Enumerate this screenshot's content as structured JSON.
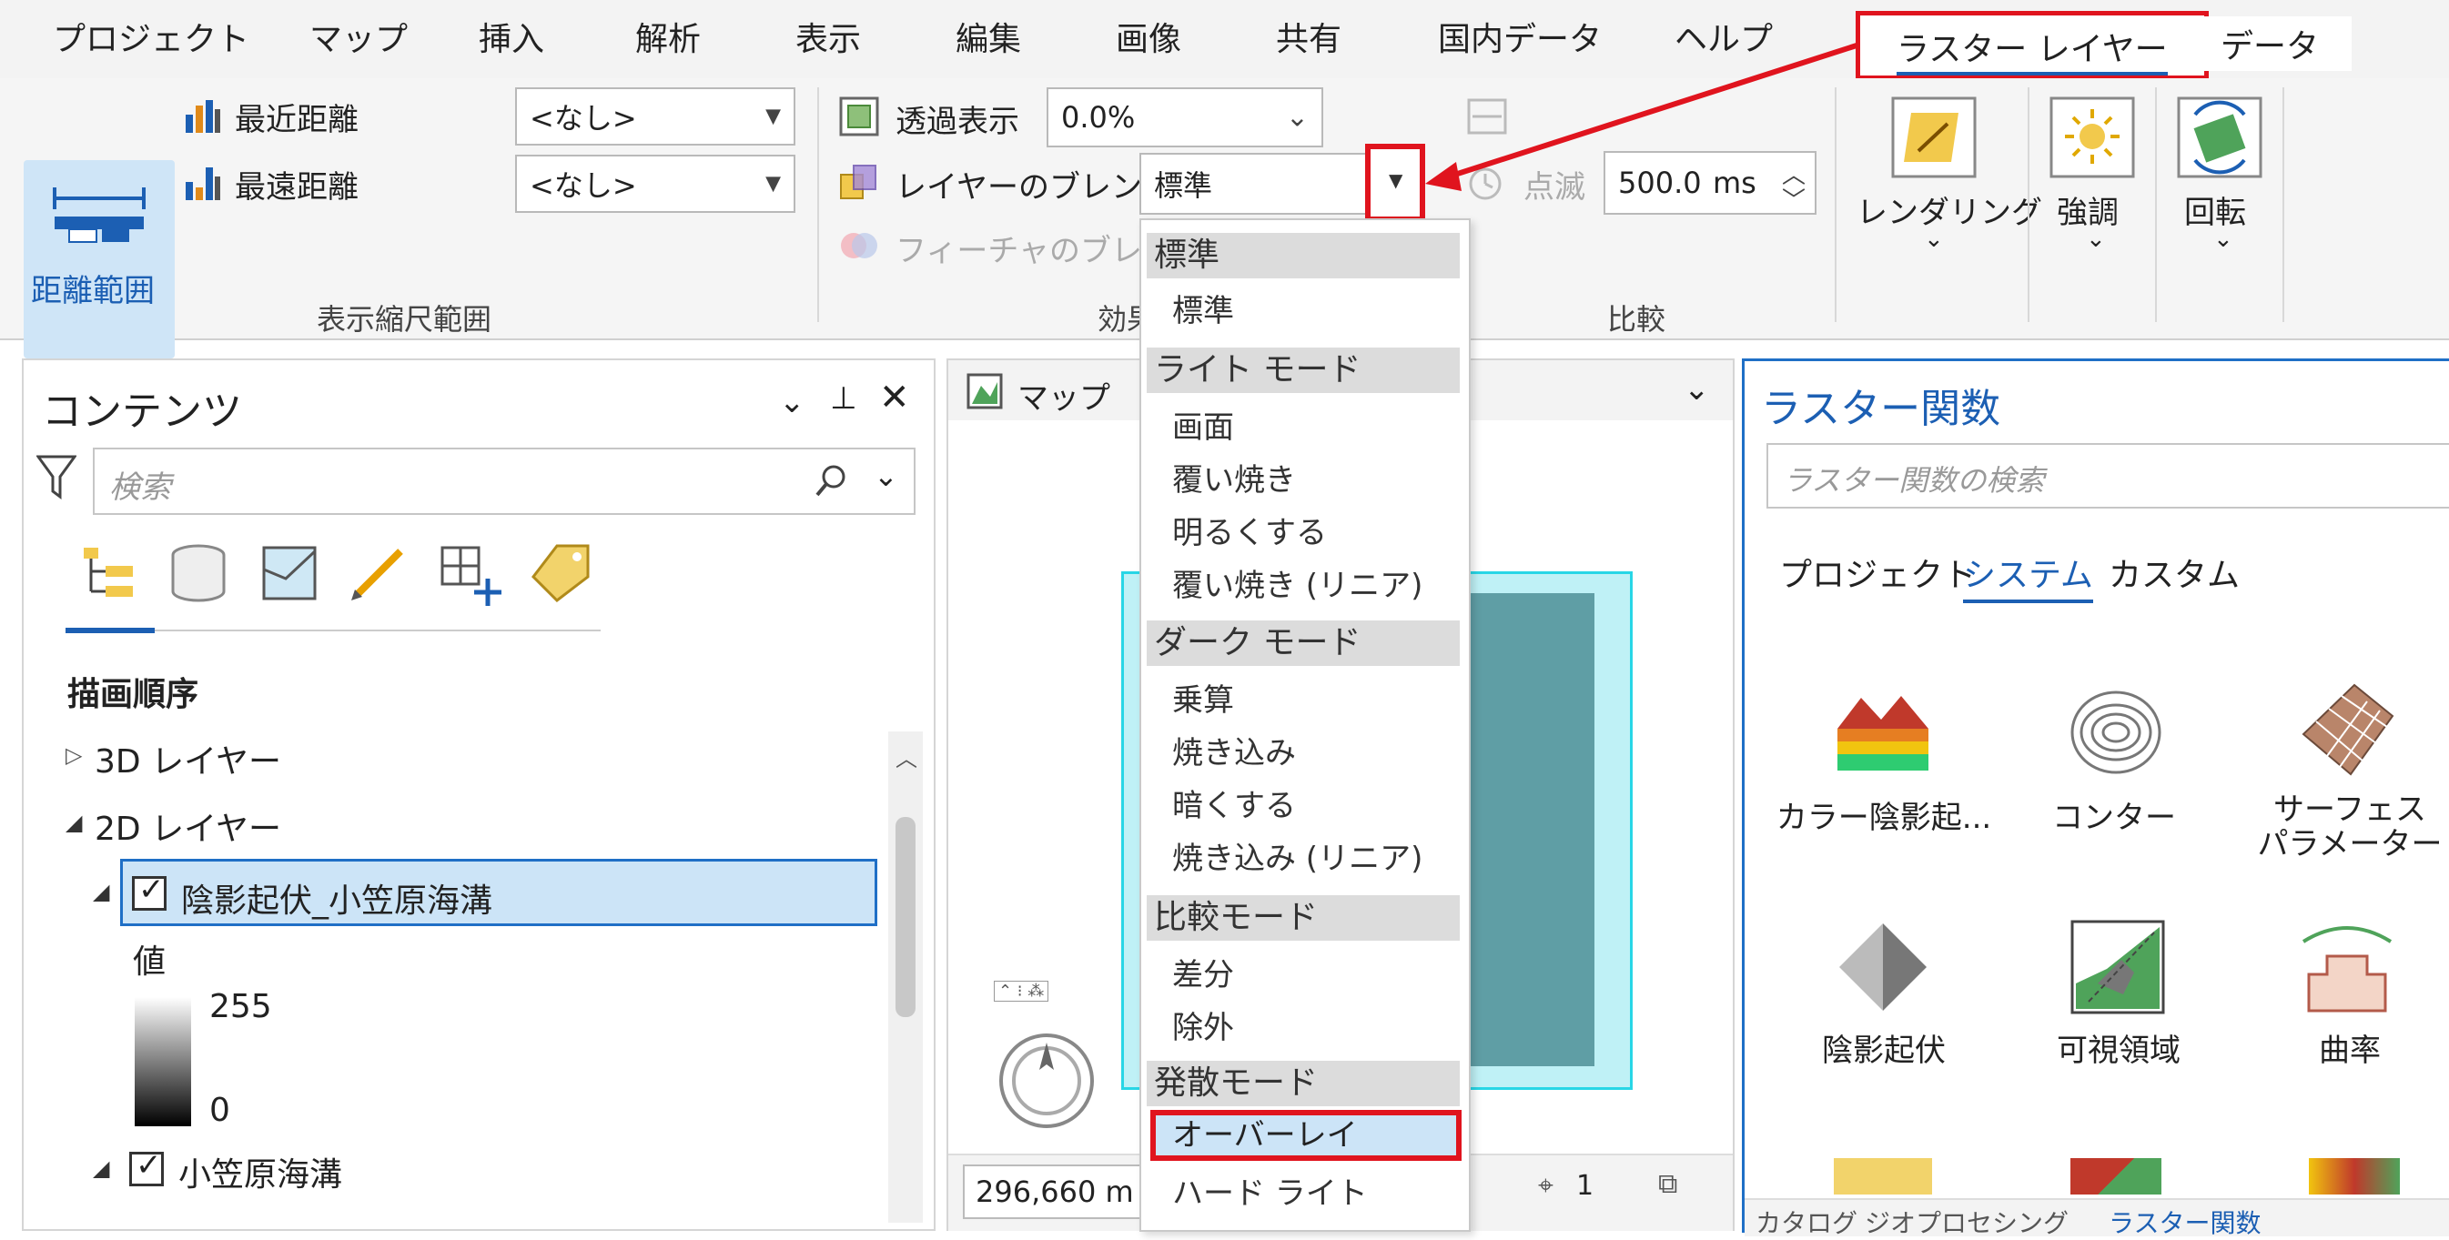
{
  "ribbon_tabs": [
    "プロジェクト",
    "マップ",
    "挿入",
    "解析",
    "表示",
    "編集",
    "画像",
    "共有",
    "国内データ",
    "ヘルプ"
  ],
  "active_tab": "ラスター レイヤー",
  "data_tab": "データ",
  "scale_group": {
    "distance_range_label": "距離範囲",
    "nearest_label": "最近距離",
    "farthest_label": "最遠距離",
    "nearest_value": "<なし>",
    "farthest_value": "<なし>",
    "group_label": "表示縮尺範囲"
  },
  "effects_group": {
    "transparency_label": "透過表示",
    "transparency_value": "0.0%",
    "layer_blend_label": "レイヤーのブレンド",
    "layer_blend_value": "標準",
    "feature_blend_label": "フィーチャのブレンド",
    "group_label": "効果"
  },
  "compare_group": {
    "flicker_label": "点滅",
    "flicker_value": "500.0",
    "flicker_unit": "ms",
    "group_label": "比較"
  },
  "rendering_label": "レンダリング",
  "enhance_label": "強調",
  "rotate_label": "回転",
  "blend_dropdown": {
    "sections": [
      {
        "header": "標準",
        "items": [
          "標準"
        ]
      },
      {
        "header": "ライト モード",
        "items": [
          "画面",
          "覆い焼き",
          "明るくする",
          "覆い焼き (リニア)"
        ]
      },
      {
        "header": "ダーク モード",
        "items": [
          "乗算",
          "焼き込み",
          "暗くする",
          "焼き込み (リニア)"
        ]
      },
      {
        "header": "比較モード",
        "items": [
          "差分",
          "除外"
        ]
      },
      {
        "header": "発散モード",
        "items": [
          "オーバーレイ",
          "ハード ライト"
        ]
      }
    ],
    "selected": "オーバーレイ"
  },
  "contents": {
    "title": "コンテンツ",
    "search_placeholder": "検索",
    "drawing_order": "描画順序",
    "layer_3d": "3D レイヤー",
    "layer_2d": "2D レイヤー",
    "layer1": "陰影起伏_小笠原海溝",
    "value_label": "値",
    "legend_max": "255",
    "legend_min": "0",
    "layer2": "小笠原海溝"
  },
  "map": {
    "tab_label": "マップ",
    "scale_text": "296,660 m",
    "nav_count": "1"
  },
  "raster_functions": {
    "title": "ラスター関数",
    "search_placeholder": "ラスター関数の検索",
    "tabs": [
      "プロジェクト",
      "システム",
      "カスタム"
    ],
    "active_tab": "システム",
    "functions": [
      "カラー陰影起...",
      "コンター",
      "サーフェス\nパラメーター",
      "陰影起伏",
      "可視領域",
      "曲率"
    ],
    "bottom_tabs": [
      "カタログ",
      "ジオプロセシング",
      "ラスター関数"
    ]
  },
  "colors": {
    "highlight": "#e0141e",
    "accent": "#1c5fb3",
    "selection": "#cce4f7"
  }
}
